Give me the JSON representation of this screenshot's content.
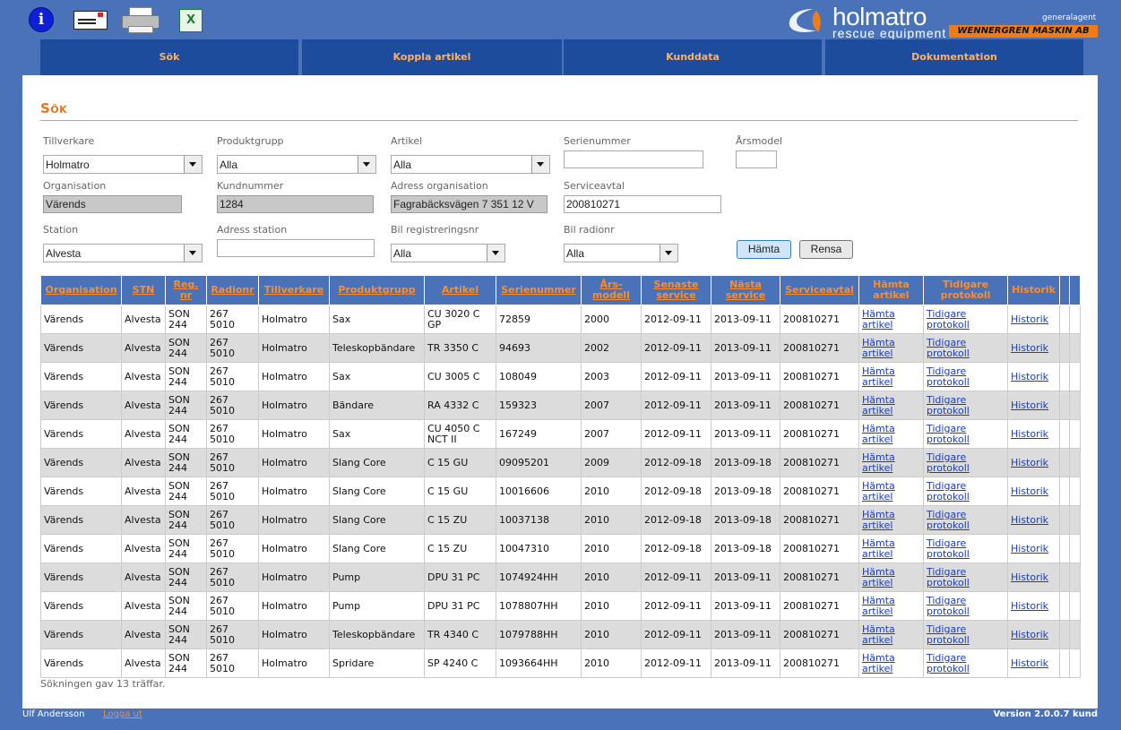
{
  "toolbar": {
    "info_glyph": "i",
    "excel_glyph": "X",
    "icons": [
      "info-icon",
      "document-icon",
      "printer-icon",
      "excel-icon"
    ]
  },
  "logo": {
    "name": "holmatro",
    "sub": "rescue equipment",
    "agent": "generalagent",
    "dealer": "WENNERGREN MASKIN AB",
    "accent": "#f07c16"
  },
  "nav": {
    "tabs": [
      "Sök",
      "Koppla artikel",
      "Kunddata",
      "Dokumentation"
    ]
  },
  "page": {
    "title": "Sök"
  },
  "form": {
    "tillverkare": {
      "label": "Tillverkare",
      "value": "Holmatro"
    },
    "produktgrupp": {
      "label": "Produktgrupp",
      "value": "Alla"
    },
    "artikel": {
      "label": "Artikel",
      "value": "Alla"
    },
    "serienummer": {
      "label": "Serienummer",
      "value": ""
    },
    "arsmodel": {
      "label": "Årsmodel",
      "value": ""
    },
    "organisation": {
      "label": "Organisation",
      "value": "Värends"
    },
    "kundnummer": {
      "label": "Kundnummer",
      "value": "1284"
    },
    "adress_org": {
      "label": "Adress organisation",
      "value": "Fagrabäcksvägen 7 351 12 V"
    },
    "serviceavtal": {
      "label": "Serviceavtal",
      "value": "200810271"
    },
    "station": {
      "label": "Station",
      "value": "Alvesta"
    },
    "adress_station": {
      "label": "Adress station",
      "value": ""
    },
    "bil_reg": {
      "label": "Bil registreringsnr",
      "value": "Alla"
    },
    "bil_radio": {
      "label": "Bil radionr",
      "value": "Alla"
    },
    "btn_hamta": "Hämta",
    "btn_rensa": "Rensa"
  },
  "table": {
    "headers": [
      "Organisation",
      "STN",
      "Reg. nr",
      "Radionr",
      "Tillverkare",
      "Produktgrupp",
      "Artikel",
      "Serienummer",
      "Års-modell",
      "Senaste service",
      "Nästa service",
      "Serviceavtal",
      "Hämta artikel",
      "Tidigare protokoll",
      "Historik"
    ],
    "rows": [
      [
        "Värends",
        "Alvesta",
        "SON 244",
        "267 5010",
        "Holmatro",
        "Sax",
        "CU 3020 C GP",
        "72859",
        "2000",
        "2012-09-11",
        "2013-09-11",
        "200810271",
        "Hämta artikel",
        "Tidigare protokoll",
        "Historik"
      ],
      [
        "Värends",
        "Alvesta",
        "SON 244",
        "267 5010",
        "Holmatro",
        "Teleskopbändare",
        "TR 3350 C",
        "94693",
        "2002",
        "2012-09-11",
        "2013-09-11",
        "200810271",
        "Hämta artikel",
        "Tidigare protokoll",
        "Historik"
      ],
      [
        "Värends",
        "Alvesta",
        "SON 244",
        "267 5010",
        "Holmatro",
        "Sax",
        "CU 3005 C",
        "108049",
        "2003",
        "2012-09-11",
        "2013-09-11",
        "200810271",
        "Hämta artikel",
        "Tidigare protokoll",
        "Historik"
      ],
      [
        "Värends",
        "Alvesta",
        "SON 244",
        "267 5010",
        "Holmatro",
        "Bändare",
        "RA 4332 C",
        "159323",
        "2007",
        "2012-09-11",
        "2013-09-11",
        "200810271",
        "Hämta artikel",
        "Tidigare protokoll",
        "Historik"
      ],
      [
        "Värends",
        "Alvesta",
        "SON 244",
        "267 5010",
        "Holmatro",
        "Sax",
        "CU 4050 C NCT II",
        "167249",
        "2007",
        "2012-09-11",
        "2013-09-11",
        "200810271",
        "Hämta artikel",
        "Tidigare protokoll",
        "Historik"
      ],
      [
        "Värends",
        "Alvesta",
        "SON 244",
        "267 5010",
        "Holmatro",
        "Slang Core",
        "C 15 GU",
        "09095201",
        "2009",
        "2012-09-18",
        "2013-09-18",
        "200810271",
        "Hämta artikel",
        "Tidigare protokoll",
        "Historik"
      ],
      [
        "Värends",
        "Alvesta",
        "SON 244",
        "267 5010",
        "Holmatro",
        "Slang Core",
        "C 15 GU",
        "10016606",
        "2010",
        "2012-09-18",
        "2013-09-18",
        "200810271",
        "Hämta artikel",
        "Tidigare protokoll",
        "Historik"
      ],
      [
        "Värends",
        "Alvesta",
        "SON 244",
        "267 5010",
        "Holmatro",
        "Slang Core",
        "C 15 ZU",
        "10037138",
        "2010",
        "2012-09-18",
        "2013-09-18",
        "200810271",
        "Hämta artikel",
        "Tidigare protokoll",
        "Historik"
      ],
      [
        "Värends",
        "Alvesta",
        "SON 244",
        "267 5010",
        "Holmatro",
        "Slang Core",
        "C 15 ZU",
        "10047310",
        "2010",
        "2012-09-18",
        "2013-09-18",
        "200810271",
        "Hämta artikel",
        "Tidigare protokoll",
        "Historik"
      ],
      [
        "Värends",
        "Alvesta",
        "SON 244",
        "267 5010",
        "Holmatro",
        "Pump",
        "DPU 31 PC",
        "1074924HH",
        "2010",
        "2012-09-11",
        "2013-09-11",
        "200810271",
        "Hämta artikel",
        "Tidigare protokoll",
        "Historik"
      ],
      [
        "Värends",
        "Alvesta",
        "SON 244",
        "267 5010",
        "Holmatro",
        "Pump",
        "DPU 31 PC",
        "1078807HH",
        "2010",
        "2012-09-11",
        "2013-09-11",
        "200810271",
        "Hämta artikel",
        "Tidigare protokoll",
        "Historik"
      ],
      [
        "Värends",
        "Alvesta",
        "SON 244",
        "267 5010",
        "Holmatro",
        "Teleskopbändare",
        "TR 4340 C",
        "1079788HH",
        "2010",
        "2012-09-11",
        "2013-09-11",
        "200810271",
        "Hämta artikel",
        "Tidigare protokoll",
        "Historik"
      ],
      [
        "Värends",
        "Alvesta",
        "SON 244",
        "267 5010",
        "Holmatro",
        "Spridare",
        "SP 4240 C",
        "1093664HH",
        "2010",
        "2012-09-11",
        "2013-09-11",
        "200810271",
        "Hämta artikel",
        "Tidigare protokoll",
        "Historik"
      ]
    ],
    "result_text": "Sökningen gav 13 träffar."
  },
  "footer": {
    "user": "Ulf Andersson",
    "logout": "Logga ut",
    "version": "Version 2.0.0.7 kund"
  }
}
